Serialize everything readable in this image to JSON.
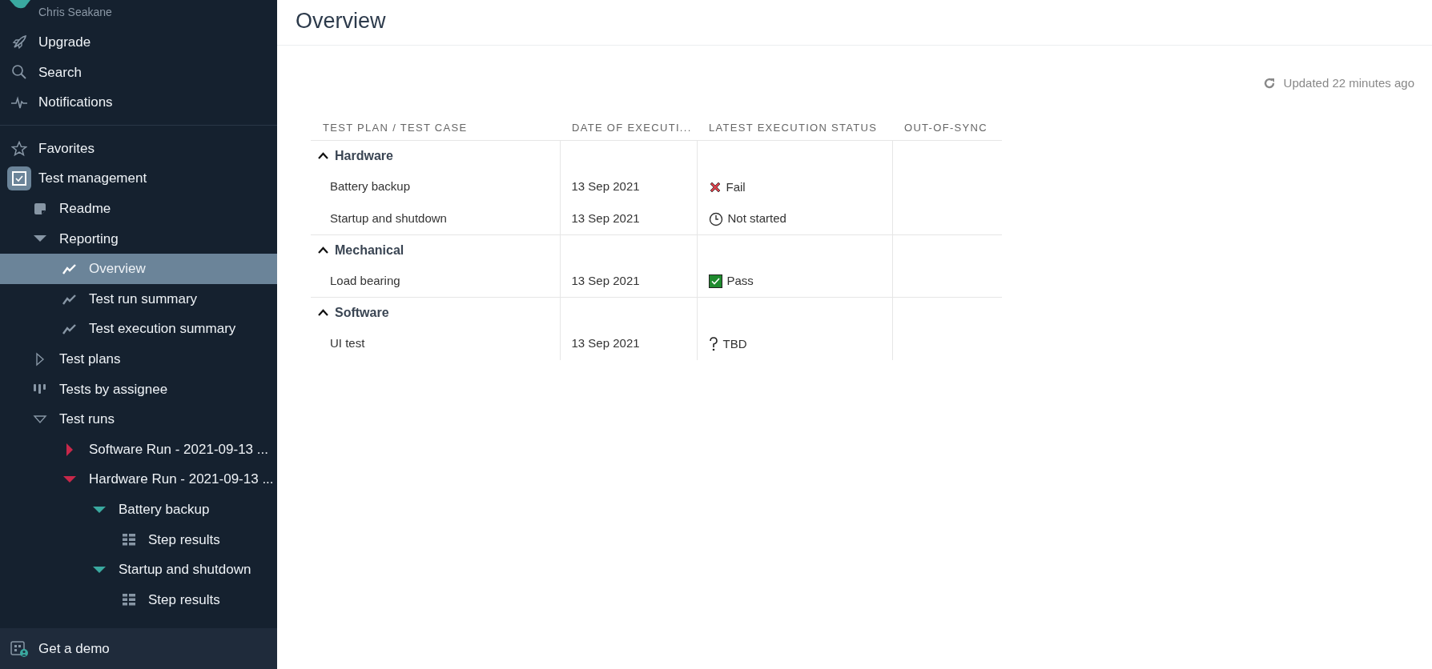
{
  "sidebar": {
    "user": "Chris Seakane",
    "top_items": [
      {
        "label": "Upgrade",
        "kind": "upgrade",
        "selected": false
      },
      {
        "label": "Search",
        "kind": "search",
        "selected": false
      },
      {
        "label": "Notifications",
        "kind": "notifications",
        "selected": false
      }
    ],
    "tree": [
      {
        "label": "Favorites",
        "kind": "favorites",
        "selected": false
      },
      {
        "label": "Test management",
        "kind": "app",
        "selected": false,
        "children": [
          {
            "label": "Readme",
            "kind": "readme",
            "selected": false
          },
          {
            "label": "Reporting",
            "kind": "folder",
            "expanded": true,
            "selected": false,
            "children": [
              {
                "label": "Overview",
                "kind": "report",
                "selected": true
              },
              {
                "label": "Test run summary",
                "kind": "report",
                "selected": false
              },
              {
                "label": "Test execution summary",
                "kind": "report",
                "selected": false
              }
            ]
          },
          {
            "label": "Test plans",
            "kind": "group",
            "expanded": false,
            "selected": false
          },
          {
            "label": "Tests by assignee",
            "kind": "assignee",
            "selected": false
          },
          {
            "label": "Test runs",
            "kind": "group",
            "expanded": true,
            "selected": false,
            "children": [
              {
                "label": "Software Run - 2021-09-13 ...",
                "kind": "run",
                "expanded": false,
                "selected": false
              },
              {
                "label": "Hardware Run - 2021-09-13 ...",
                "kind": "run",
                "expanded": true,
                "selected": false,
                "children": [
                  {
                    "label": "Battery backup",
                    "kind": "case",
                    "expanded": true,
                    "selected": false,
                    "children": [
                      {
                        "label": "Step results",
                        "kind": "steps",
                        "selected": false
                      }
                    ]
                  },
                  {
                    "label": "Startup and shutdown",
                    "kind": "case",
                    "expanded": true,
                    "selected": false,
                    "children": [
                      {
                        "label": "Step results",
                        "kind": "steps",
                        "selected": false
                      }
                    ]
                  }
                ]
              }
            ]
          }
        ]
      }
    ],
    "footer": {
      "label": "Get a demo"
    }
  },
  "page": {
    "title": "Overview",
    "updated": "Updated 22 minutes ago"
  },
  "table": {
    "columns": [
      "TEST PLAN / TEST CASE",
      "DATE OF EXECUTI...",
      "LATEST EXECUTION STATUS",
      "OUT-OF-SYNC"
    ],
    "groups": [
      {
        "name": "Hardware",
        "expanded": true,
        "rows": [
          {
            "name": "Battery backup",
            "date": "13 Sep 2021",
            "status": {
              "kind": "fail",
              "label": "Fail"
            }
          },
          {
            "name": "Startup and shutdown",
            "date": "13 Sep 2021",
            "status": {
              "kind": "not-started",
              "label": "Not started"
            }
          }
        ]
      },
      {
        "name": "Mechanical",
        "expanded": true,
        "rows": [
          {
            "name": "Load bearing",
            "date": "13 Sep 2021",
            "status": {
              "kind": "pass",
              "label": "Pass"
            }
          }
        ]
      },
      {
        "name": "Software",
        "expanded": true,
        "rows": [
          {
            "name": "UI test",
            "date": "13 Sep 2021",
            "status": {
              "kind": "tbd",
              "label": "TBD"
            }
          }
        ]
      }
    ]
  }
}
